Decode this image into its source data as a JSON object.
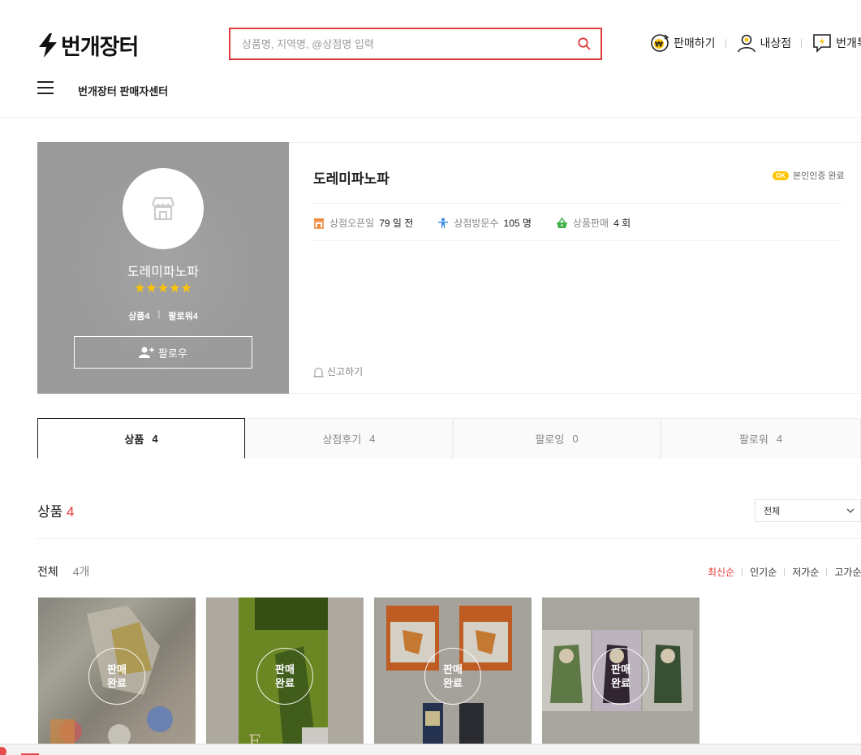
{
  "header": {
    "logo_text": "번개장터",
    "search_placeholder": "상품명, 지역명, @상점명 입력",
    "links": [
      {
        "label": "판매하기",
        "icon": "won-coin-icon"
      },
      {
        "label": "내상점",
        "icon": "user-icon"
      },
      {
        "label": "번개톡",
        "icon": "chat-bolt-icon"
      }
    ],
    "seller_center": "번개장터 판매자센터"
  },
  "shop": {
    "name": "도레미파노파",
    "rating_stars": "★★★★★",
    "products_label": "상품4",
    "followers_label": "팔로워4",
    "follow_button": "팔로우",
    "verified_badge": "OK",
    "verified_text": "본인인증 완료",
    "stats": [
      {
        "label": "상점오픈일",
        "value": "79 일 전",
        "icon": "store-icon",
        "color": "#f08a3c"
      },
      {
        "label": "상점방문수",
        "value": "105 명",
        "icon": "visitor-icon",
        "color": "#3d8de6"
      },
      {
        "label": "상품판매",
        "value": "4 회",
        "icon": "basket-icon",
        "color": "#40b04a"
      }
    ],
    "report": "신고하기"
  },
  "tabs": [
    {
      "label": "상품",
      "count": "4"
    },
    {
      "label": "상점후기",
      "count": "4"
    },
    {
      "label": "팔로잉",
      "count": "0"
    },
    {
      "label": "팔로워",
      "count": "4"
    }
  ],
  "products": {
    "title": "상품",
    "count": "4",
    "filter_value": "전체",
    "all_label": "전체",
    "all_count": "4개",
    "sort_options": [
      "최신순",
      "인기순",
      "저가순",
      "고가순"
    ],
    "sold_line1": "판매",
    "sold_line2": "완료",
    "items": [
      {
        "name": "product-1"
      },
      {
        "name": "product-2"
      },
      {
        "name": "product-3"
      },
      {
        "name": "product-4"
      }
    ]
  },
  "colors": {
    "accent": "#e53935",
    "search_border": "#e03a3a",
    "star": "#ffc400"
  }
}
